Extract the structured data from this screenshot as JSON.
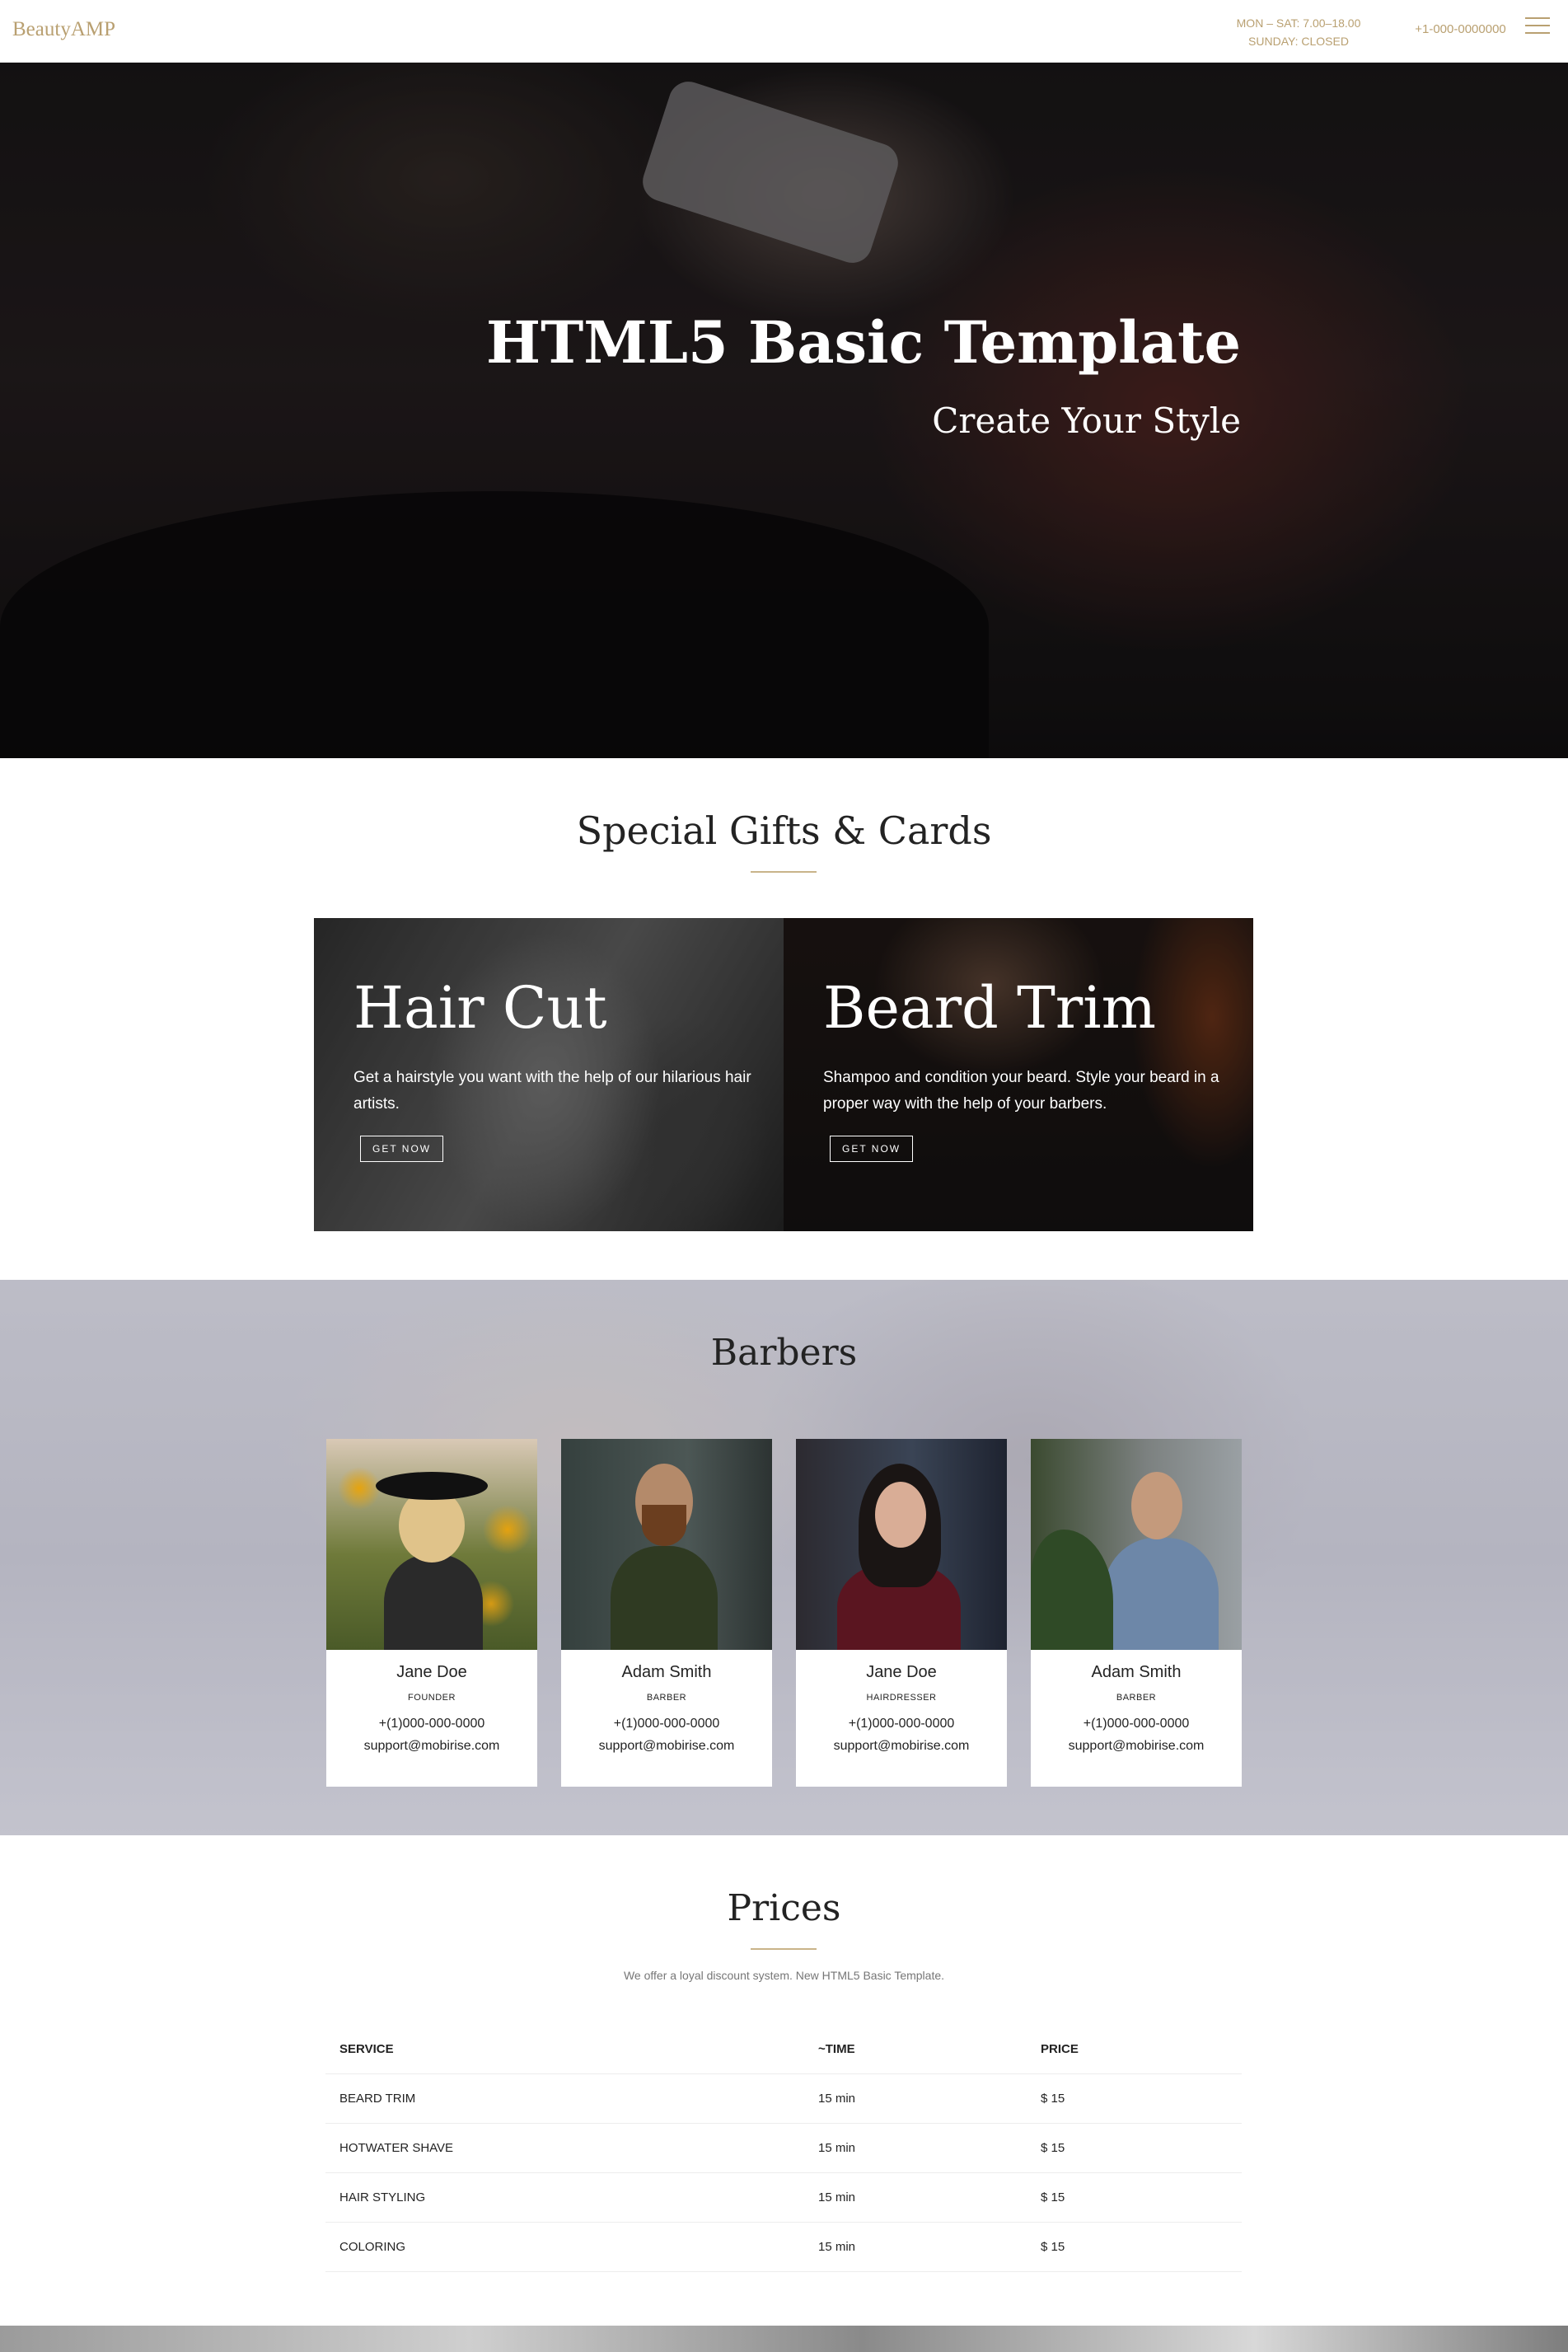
{
  "navbar": {
    "brand": "BeautyAMP",
    "hours_line1": "MON – SAT: 7.00–18.00",
    "hours_line2": "SUNDAY: CLOSED",
    "phone": "+1-000-0000000",
    "menu_icon": "hamburger-icon"
  },
  "hero": {
    "title": "HTML5 Basic Template",
    "subtitle": "Create Your Style"
  },
  "gifts": {
    "title": "Special Gifts & Cards",
    "cards": [
      {
        "title": "Hair Cut",
        "text": "Get a hairstyle you want with the help of our hilarious hair artists.",
        "button": "GET NOW"
      },
      {
        "title": "Beard Trim",
        "text": "Shampoo and condition your beard. Style your beard in a proper way with the help of your barbers.",
        "button": "GET NOW"
      }
    ]
  },
  "barbers": {
    "title": "Barbers",
    "members": [
      {
        "name": "Jane Doe",
        "role": "FOUNDER",
        "phone": "+(1)000-000-0000",
        "email": "support@mobirise.com"
      },
      {
        "name": "Adam Smith",
        "role": "BARBER",
        "phone": "+(1)000-000-0000",
        "email": "support@mobirise.com"
      },
      {
        "name": "Jane Doe",
        "role": "HAIRDRESSER",
        "phone": "+(1)000-000-0000",
        "email": "support@mobirise.com"
      },
      {
        "name": "Adam Smith",
        "role": "BARBER",
        "phone": "+(1)000-000-0000",
        "email": "support@mobirise.com"
      }
    ]
  },
  "prices": {
    "title": "Prices",
    "note": "We offer a loyal discount system. New HTML5 Basic Template.",
    "headers": [
      "SERVICE",
      "~TIME",
      "PRICE"
    ],
    "rows": [
      [
        "BEARD TRIM",
        "15 min",
        "$ 15"
      ],
      [
        "HOTWATER SHAVE",
        "15 min",
        "$ 15"
      ],
      [
        "HAIR STYLING",
        "15 min",
        "$ 15"
      ],
      [
        "COLORING",
        "15 min",
        "$ 15"
      ]
    ]
  },
  "colors": {
    "accent": "#b9a071",
    "underline": "#c9b48a",
    "text": "#232323"
  }
}
